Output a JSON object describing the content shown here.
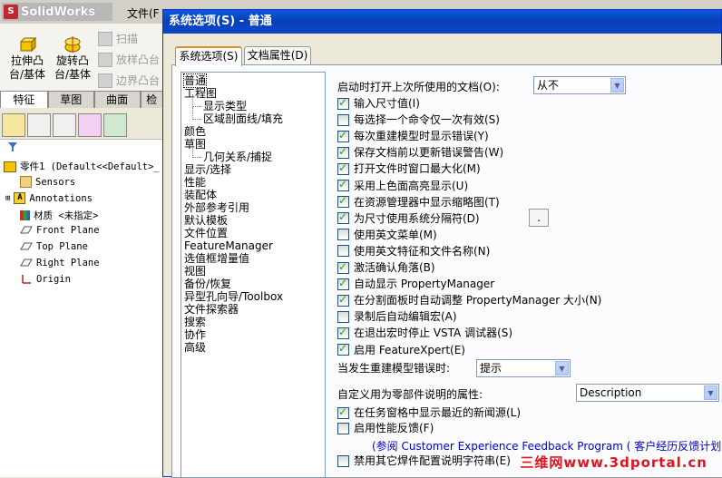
{
  "app": {
    "name": "SolidWorks",
    "menu_first": "文件(F"
  },
  "command_manager": {
    "extrude_boss": "拉伸凸\n台/基体",
    "revolve_boss": "旋转凸\n台/基体",
    "sweep": "扫描",
    "loft": "放样凸台",
    "boundary": "边界凸台"
  },
  "left_tabs": [
    "特征",
    "草图",
    "曲面",
    "检"
  ],
  "feature_tree": {
    "root": "零件1  (Default<<Default>_",
    "items": [
      "Sensors",
      "Annotations",
      "材质 <未指定>",
      "Front Plane",
      "Top Plane",
      "Right Plane",
      "Origin"
    ]
  },
  "dialog": {
    "title": "系统选项(S) - 普通",
    "tabs": [
      "系统选项(S)",
      "文档属性(D)"
    ],
    "categories": [
      {
        "label": "普通",
        "indent": 0
      },
      {
        "label": "工程图",
        "indent": 0
      },
      {
        "label": "显示类型",
        "indent": 1
      },
      {
        "label": "区域剖面线/填充",
        "indent": 1
      },
      {
        "label": "颜色",
        "indent": 0
      },
      {
        "label": "草图",
        "indent": 0
      },
      {
        "label": "几何关系/捕捉",
        "indent": 1
      },
      {
        "label": "显示/选择",
        "indent": 0
      },
      {
        "label": "性能",
        "indent": 0
      },
      {
        "label": "装配体",
        "indent": 0
      },
      {
        "label": "外部参考引用",
        "indent": 0
      },
      {
        "label": "默认模板",
        "indent": 0
      },
      {
        "label": "文件位置",
        "indent": 0
      },
      {
        "label": "FeatureManager",
        "indent": 0
      },
      {
        "label": "选值框增量值",
        "indent": 0
      },
      {
        "label": "视图",
        "indent": 0
      },
      {
        "label": "备份/恢复",
        "indent": 0
      },
      {
        "label": "异型孔向导/Toolbox",
        "indent": 0
      },
      {
        "label": "文件探索器",
        "indent": 0
      },
      {
        "label": "搜索",
        "indent": 0
      },
      {
        "label": "协作",
        "indent": 0
      },
      {
        "label": "高级",
        "indent": 0
      }
    ],
    "open_last_label": "启动时打开上次所使用的文档(O):",
    "open_last_value": "从不",
    "options": [
      {
        "label": "输入尺寸值(I)",
        "checked": true
      },
      {
        "label": "每选择一个命令仅一次有效(S)",
        "checked": false
      },
      {
        "label": "每次重建模型时显示错误(Y)",
        "checked": true
      },
      {
        "label": "保存文档前以更新错误警告(W)",
        "checked": true
      },
      {
        "label": "打开文件时窗口最大化(M)",
        "checked": true
      },
      {
        "label": "采用上色面高亮显示(U)",
        "checked": true
      },
      {
        "label": "在资源管理器中显示缩略图(T)",
        "checked": true
      },
      {
        "label": "为尺寸使用系统分隔符(D)",
        "checked": true
      },
      {
        "label": "使用英文菜单(M)",
        "checked": false
      },
      {
        "label": "使用英文特征和文件名称(N)",
        "checked": false
      },
      {
        "label": "激活确认角落(B)",
        "checked": true
      },
      {
        "label": "自动显示 PropertyManager",
        "checked": true
      },
      {
        "label": "在分割面板时自动调整 PropertyManager 大小(N)",
        "checked": true
      },
      {
        "label": "录制后自动编辑宏(A)",
        "checked": false
      },
      {
        "label": "在退出宏时停止 VSTA 调试器(S)",
        "checked": true
      },
      {
        "label": "启用 FeatureXpert(E)",
        "checked": true
      }
    ],
    "separator_value": ".",
    "rebuild_error_label": "当发生重建模型错误时:",
    "rebuild_error_value": "提示",
    "custom_prop_label": "自定义用为零部件说明的属性:",
    "custom_prop_value": "Description",
    "options2": [
      {
        "label": "在任务窗格中显示最近的新闻源(L)",
        "checked": true
      },
      {
        "label": "启用性能反馈(F)",
        "checked": false
      }
    ],
    "feedback_link": "(参阅 Customer Experience Feedback Program ( 客户经历反馈计划) )",
    "options3": [
      {
        "label": "禁用其它焊件配置说明字符串(E)",
        "checked": false
      }
    ]
  },
  "watermark": "三维网www.3dportal.cn",
  "colors": {
    "title_blue": "#0a48c8",
    "check_green": "#21a121",
    "tab_orange": "#e68b2c",
    "logo_red": "#c0282d",
    "watermark_red": "#e0141e"
  }
}
